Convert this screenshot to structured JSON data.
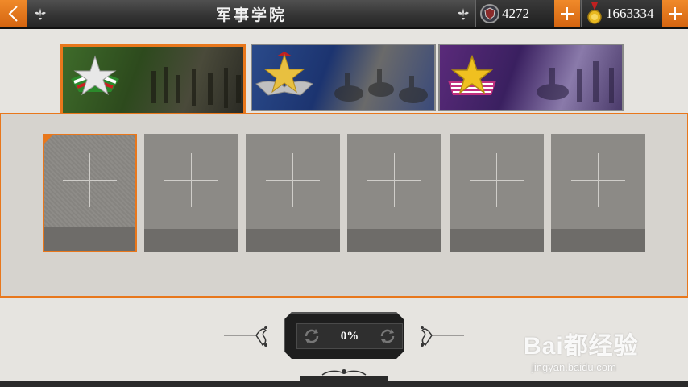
{
  "header": {
    "title": "军事学院",
    "currency_1": {
      "icon": "shield-coin-icon",
      "value": "4272"
    },
    "currency_2": {
      "icon": "gold-medal-icon",
      "value": "1663334"
    }
  },
  "tabs": [
    {
      "name": "tab-hungarian-insignia",
      "insignia": "green-white-red-star-badge",
      "active": true
    },
    {
      "name": "tab-silver-wing-insignia",
      "insignia": "silver-gold-winged-star",
      "active": false
    },
    {
      "name": "tab-gold-star-insignia",
      "insignia": "gold-star-purple-ribbon",
      "active": false
    }
  ],
  "slots": [
    {
      "state": "empty",
      "selected": true
    },
    {
      "state": "empty",
      "selected": false
    },
    {
      "state": "empty",
      "selected": false
    },
    {
      "state": "empty",
      "selected": false
    },
    {
      "state": "empty",
      "selected": false
    },
    {
      "state": "empty",
      "selected": false
    }
  ],
  "progress": {
    "label": "0%",
    "percent": 0
  },
  "watermark": {
    "brand": "Bai都经验",
    "url": "jingyan.baidu.com"
  },
  "colors": {
    "accent": "#e8771c",
    "topbar": "#333333",
    "panel": "#d6d3ce",
    "slot": "#8c8a86"
  }
}
